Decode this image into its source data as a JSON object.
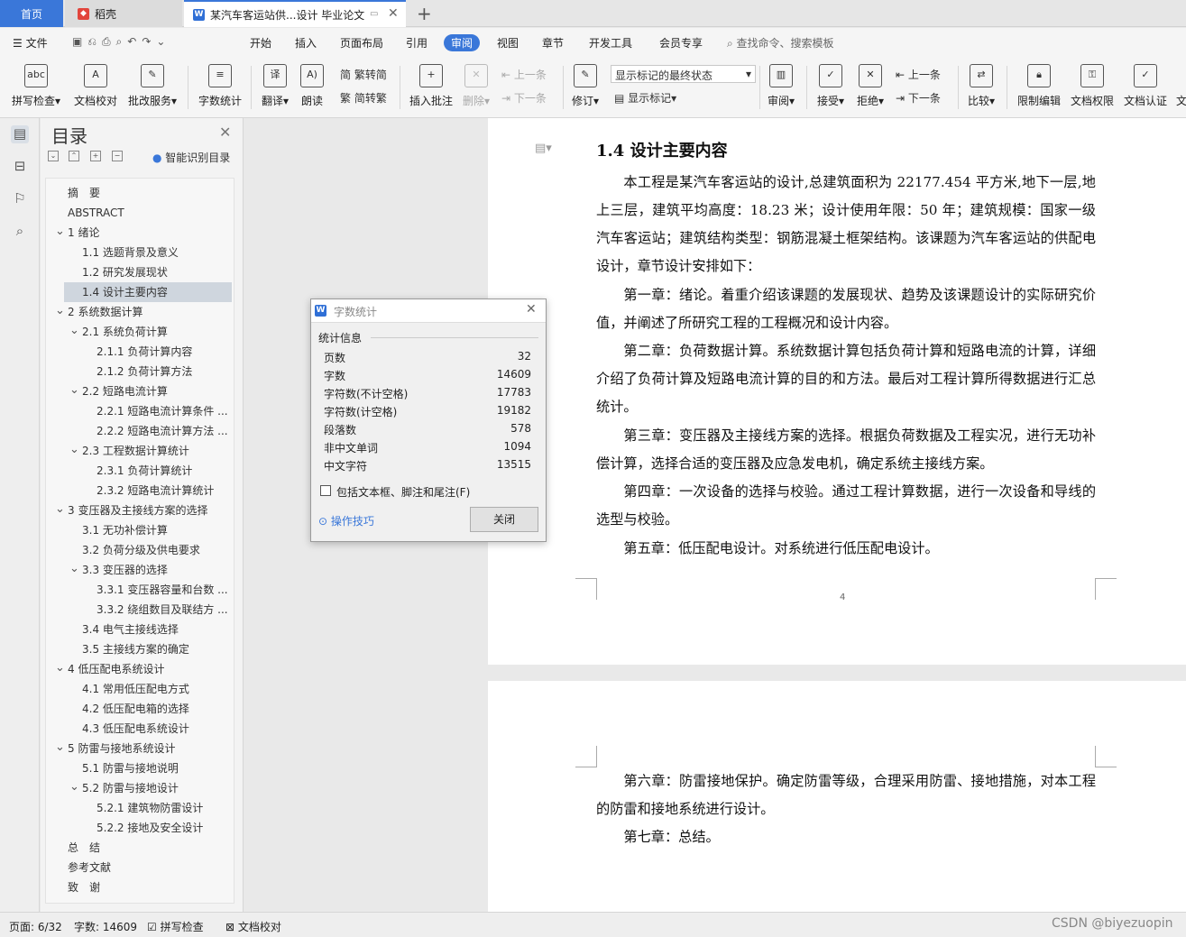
{
  "tabs": {
    "home": "首页",
    "daoke": "稻壳",
    "doc": "某汽车客运站供...设计 毕业论文",
    "add": "+"
  },
  "menu": {
    "file": "文件",
    "items": [
      "开始",
      "插入",
      "页面布局",
      "引用",
      "审阅",
      "视图",
      "章节",
      "开发工具",
      "会员专享"
    ],
    "search": "查找命令、搜索模板"
  },
  "ribbon": {
    "spell": "拼写检查",
    "proof": "文档校对",
    "annotate": "批改服务",
    "wordcount": "字数统计",
    "translate": "翻译",
    "read": "朗读",
    "t2s": "繁转简",
    "s2t": "简转繁",
    "insert_comment": "插入批注",
    "delete": "删除",
    "prev": "上一条",
    "next": "下一条",
    "revise": "修订",
    "markup_select": "显示标记的最终状态",
    "show_markup": "显示标记",
    "review": "审阅",
    "accept": "接受",
    "reject": "拒绝",
    "prev2": "上一条",
    "next2": "下一条",
    "compare": "比较",
    "restrict": "限制编辑",
    "permission": "文档权限",
    "certify": "文档认证",
    "more": "文"
  },
  "toc": {
    "title": "目录",
    "smart": "智能识别目录",
    "items": [
      {
        "label": "摘　要",
        "level": 1,
        "caret": false
      },
      {
        "label": "ABSTRACT",
        "level": 1,
        "caret": false
      },
      {
        "label": "1  绪论",
        "level": 1,
        "caret": true
      },
      {
        "label": "1.1  选题背景及意义",
        "level": 2,
        "caret": false
      },
      {
        "label": "1.2  研究发展现状",
        "level": 2,
        "caret": false
      },
      {
        "label": "1.4  设计主要内容",
        "level": 2,
        "caret": false,
        "selected": true
      },
      {
        "label": "2  系统数据计算",
        "level": 1,
        "caret": true
      },
      {
        "label": "2.1  系统负荷计算",
        "level": 2,
        "caret": true
      },
      {
        "label": "2.1.1  负荷计算内容",
        "level": 3,
        "caret": false
      },
      {
        "label": "2.1.2  负荷计算方法",
        "level": 3,
        "caret": false
      },
      {
        "label": "2.2  短路电流计算",
        "level": 2,
        "caret": true
      },
      {
        "label": "2.2.1  短路电流计算条件 ...",
        "level": 3,
        "caret": false
      },
      {
        "label": "2.2.2  短路电流计算方法 ...",
        "level": 3,
        "caret": false
      },
      {
        "label": "2.3  工程数据计算统计",
        "level": 2,
        "caret": true
      },
      {
        "label": "2.3.1  负荷计算统计",
        "level": 3,
        "caret": false
      },
      {
        "label": "2.3.2  短路电流计算统计",
        "level": 3,
        "caret": false
      },
      {
        "label": "3  变压器及主接线方案的选择",
        "level": 1,
        "caret": true
      },
      {
        "label": "3.1  无功补偿计算",
        "level": 2,
        "caret": false
      },
      {
        "label": "3.2  负荷分级及供电要求",
        "level": 2,
        "caret": false
      },
      {
        "label": "3.3  变压器的选择",
        "level": 2,
        "caret": true
      },
      {
        "label": "3.3.1  变压器容量和台数 ...",
        "level": 3,
        "caret": false
      },
      {
        "label": "3.3.2  绕组数目及联结方 ...",
        "level": 3,
        "caret": false
      },
      {
        "label": "3.4  电气主接线选择",
        "level": 2,
        "caret": false
      },
      {
        "label": "3.5 主接线方案的确定",
        "level": 2,
        "caret": false
      },
      {
        "label": "4  低压配电系统设计",
        "level": 1,
        "caret": true
      },
      {
        "label": "4.1  常用低压配电方式",
        "level": 2,
        "caret": false
      },
      {
        "label": "4.2  低压配电箱的选择",
        "level": 2,
        "caret": false
      },
      {
        "label": "4.3  低压配电系统设计",
        "level": 2,
        "caret": false
      },
      {
        "label": "5  防雷与接地系统设计",
        "level": 1,
        "caret": true
      },
      {
        "label": "5.1 防雷与接地说明",
        "level": 2,
        "caret": false
      },
      {
        "label": "5.2  防雷与接地设计",
        "level": 2,
        "caret": true
      },
      {
        "label": "5.2.1  建筑物防雷设计",
        "level": 3,
        "caret": false
      },
      {
        "label": "5.2.2 接地及安全设计",
        "level": 3,
        "caret": false
      },
      {
        "label": "总　结",
        "level": 1,
        "caret": false
      },
      {
        "label": "参考文献",
        "level": 1,
        "caret": false
      },
      {
        "label": "致　谢",
        "level": 1,
        "caret": false
      }
    ]
  },
  "document": {
    "heading": "1.4  设计主要内容",
    "p1": "本工程是某汽车客运站的设计,总建筑面积为  22177.454 平方米,地下一层,地上三层，建筑平均高度：18.23 米；设计使用年限：50 年；建筑规模：国家一级汽车客运站；建筑结构类型：钢筋混凝土框架结构。该课题为汽车客运站的供配电设计，章节设计安排如下：",
    "p2": "第一章：绪论。着重介绍该课题的发展现状、趋势及该课题设计的实际研究价值，并阐述了所研究工程的工程概况和设计内容。",
    "p3": "第二章：负荷数据计算。系统数据计算包括负荷计算和短路电流的计算，详细介绍了负荷计算及短路电流计算的目的和方法。最后对工程计算所得数据进行汇总统计。",
    "p4": "第三章：变压器及主接线方案的选择。根据负荷数据及工程实况，进行无功补偿计算，选择合适的变压器及应急发电机，确定系统主接线方案。",
    "p5": "第四章：一次设备的选择与校验。通过工程计算数据，进行一次设备和导线的选型与校验。",
    "p6": "第五章：低压配电设计。对系统进行低压配电设计。",
    "page_number": "4",
    "p7": "第六章：防雷接地保护。确定防雷等级，合理采用防雷、接地措施，对本工程的防雷和接地系统进行设计。",
    "p8": "第七章：总结。"
  },
  "dialog": {
    "title": "字数统计",
    "section": "统计信息",
    "rows": [
      {
        "label": "页数",
        "value": "32"
      },
      {
        "label": "字数",
        "value": "14609"
      },
      {
        "label": "字符数(不计空格)",
        "value": "17783"
      },
      {
        "label": "字符数(计空格)",
        "value": "19182"
      },
      {
        "label": "段落数",
        "value": "578"
      },
      {
        "label": "非中文单词",
        "value": "1094"
      },
      {
        "label": "中文字符",
        "value": "13515"
      }
    ],
    "checkbox": "包括文本框、脚注和尾注(F)",
    "tips": "操作技巧",
    "close": "关闭"
  },
  "status": {
    "page": "页面: 6/32",
    "words": "字数: 14609",
    "spell": "拼写检查",
    "proof": "文档校对"
  },
  "watermark": "CSDN @biyezuopin",
  "colors": {
    "accent": "#3a77d9",
    "selected": "#cfd6de"
  }
}
